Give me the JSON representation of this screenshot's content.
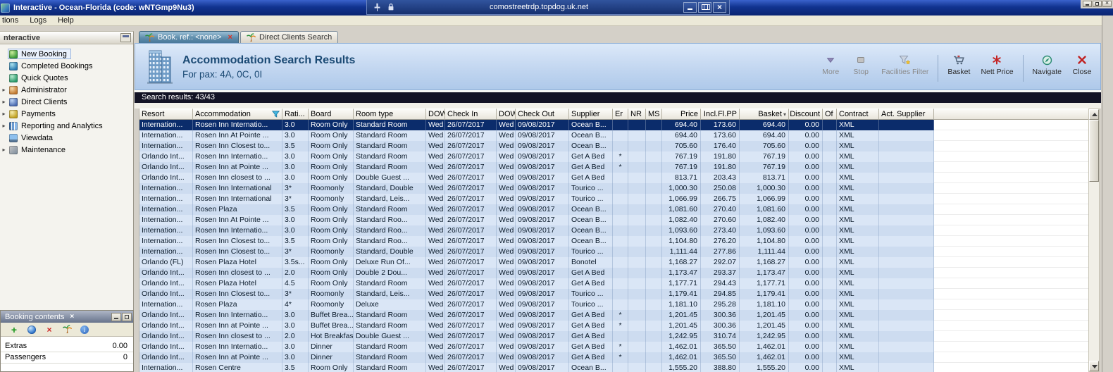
{
  "colors": {
    "selected_row": "#0b2c6b",
    "row_light": "#dae6f6",
    "row_dark": "#cddcf0",
    "titlebar": "#11338f",
    "results_bar": "#131325",
    "header_text": "#1b4a74"
  },
  "window": {
    "title": "Interactive - Ocean-Florida (code: wNTGmp9Nu3)",
    "rdp_host": "comostreetrdp.topdog.uk.net"
  },
  "menu": {
    "items": [
      "tions",
      "Logs",
      "Help"
    ]
  },
  "sidebar": {
    "title": "nteractive",
    "items": [
      {
        "label": "New Booking",
        "icon": "new-booking-icon",
        "selected": true,
        "expandable": false
      },
      {
        "label": "Completed Bookings",
        "icon": "completed-bookings-icon",
        "expandable": false
      },
      {
        "label": "Quick Quotes",
        "icon": "quick-quotes-icon",
        "expandable": false
      },
      {
        "label": "Administrator",
        "icon": "administrator-icon",
        "expandable": true
      },
      {
        "label": "Direct Clients",
        "icon": "direct-clients-icon",
        "expandable": true
      },
      {
        "label": "Payments",
        "icon": "payments-icon",
        "expandable": true
      },
      {
        "label": "Reporting and Analytics",
        "icon": "reporting-analytics-icon",
        "expandable": true
      },
      {
        "label": "Viewdata",
        "icon": "viewdata-icon",
        "expandable": false
      },
      {
        "label": "Maintenance",
        "icon": "maintenance-icon",
        "expandable": true
      }
    ]
  },
  "booking_contents": {
    "title": "Booking contents",
    "toolbar_icons": [
      "add-icon",
      "globe-icon",
      "delete-icon",
      "palm-icon",
      "info-icon"
    ],
    "rows": [
      {
        "label": "Extras",
        "value": "0.00"
      },
      {
        "label": "Passengers",
        "value": "0"
      }
    ]
  },
  "tabs": [
    {
      "label": "Book. ref.: <none>",
      "active": true,
      "closable": true
    },
    {
      "label": "Direct Clients Search",
      "active": false,
      "closable": false
    }
  ],
  "header": {
    "title": "Accommodation Search Results",
    "subtitle": "For pax: 4A, 0C, 0I",
    "toolbar": [
      {
        "label": "More",
        "icon": "more-icon",
        "disabled": true
      },
      {
        "label": "Stop",
        "icon": "stop-icon",
        "disabled": true
      },
      {
        "label": "Facilities Filter",
        "icon": "facilities-filter-icon",
        "disabled": true
      },
      {
        "separator": true
      },
      {
        "label": "Basket",
        "icon": "basket-icon",
        "disabled": false
      },
      {
        "label": "Nett Price",
        "icon": "nett-price-icon",
        "disabled": false
      },
      {
        "separator": true
      },
      {
        "label": "Navigate",
        "icon": "navigate-icon",
        "disabled": false
      },
      {
        "label": "Close",
        "icon": "close-red-icon",
        "disabled": false
      }
    ]
  },
  "results": {
    "status": "Search results: 43/43",
    "selected_row": 0,
    "columns": [
      "Resort",
      "Accommodation",
      "Rati...",
      "Board",
      "Room type",
      "DOW",
      "Check In",
      "DOW",
      "Check Out",
      "Supplier",
      "Er",
      "NR",
      "MS",
      "Price",
      "Incl.Fl.PP",
      "Basket",
      "Discount",
      "Of",
      "Contract",
      "Act. Supplier"
    ],
    "rows": [
      [
        "Internation...",
        "Rosen Inn Internatio...",
        "3.0",
        "Room Only",
        "Standard Room",
        "Wed",
        "26/07/2017",
        "Wed",
        "09/08/2017",
        "Ocean B...",
        "",
        "",
        "",
        "694.40",
        "173.60",
        "694.40",
        "0.00",
        "",
        "XML",
        ""
      ],
      [
        "Internation...",
        "Rosen Inn At Pointe ...",
        "3.0",
        "Room Only",
        "Standard Room",
        "Wed",
        "26/07/2017",
        "Wed",
        "09/08/2017",
        "Ocean B...",
        "",
        "",
        "",
        "694.40",
        "173.60",
        "694.40",
        "0.00",
        "",
        "XML",
        ""
      ],
      [
        "Internation...",
        "Rosen Inn Closest to...",
        "3.5",
        "Room Only",
        "Standard Room",
        "Wed",
        "26/07/2017",
        "Wed",
        "09/08/2017",
        "Ocean B...",
        "",
        "",
        "",
        "705.60",
        "176.40",
        "705.60",
        "0.00",
        "",
        "XML",
        ""
      ],
      [
        "Orlando Int...",
        "Rosen Inn Internatio...",
        "3.0",
        "Room Only",
        "Standard Room",
        "Wed",
        "26/07/2017",
        "Wed",
        "09/08/2017",
        "Get A Bed",
        "*",
        "",
        "",
        "767.19",
        "191.80",
        "767.19",
        "0.00",
        "",
        "XML",
        ""
      ],
      [
        "Orlando Int...",
        "Rosen Inn at Pointe ...",
        "3.0",
        "Room Only",
        "Standard Room",
        "Wed",
        "26/07/2017",
        "Wed",
        "09/08/2017",
        "Get A Bed",
        "*",
        "",
        "",
        "767.19",
        "191.80",
        "767.19",
        "0.00",
        "",
        "XML",
        ""
      ],
      [
        "Orlando Int...",
        "Rosen Inn closest to ...",
        "3.0",
        "Room Only",
        "Double Guest ...",
        "Wed",
        "26/07/2017",
        "Wed",
        "09/08/2017",
        "Get A Bed",
        "",
        "",
        "",
        "813.71",
        "203.43",
        "813.71",
        "0.00",
        "",
        "XML",
        ""
      ],
      [
        "Internation...",
        "Rosen Inn International",
        "3*",
        "Roomonly",
        "Standard, Double",
        "Wed",
        "26/07/2017",
        "Wed",
        "09/08/2017",
        "Tourico ...",
        "",
        "",
        "",
        "1,000.30",
        "250.08",
        "1,000.30",
        "0.00",
        "",
        "XML",
        ""
      ],
      [
        "Internation...",
        "Rosen Inn International",
        "3*",
        "Roomonly",
        "Standard, Leis...",
        "Wed",
        "26/07/2017",
        "Wed",
        "09/08/2017",
        "Tourico ...",
        "",
        "",
        "",
        "1,066.99",
        "266.75",
        "1,066.99",
        "0.00",
        "",
        "XML",
        ""
      ],
      [
        "Internation...",
        "Rosen Plaza",
        "3.5",
        "Room Only",
        "Standard Room",
        "Wed",
        "26/07/2017",
        "Wed",
        "09/08/2017",
        "Ocean B...",
        "",
        "",
        "",
        "1,081.60",
        "270.40",
        "1,081.60",
        "0.00",
        "",
        "XML",
        ""
      ],
      [
        "Internation...",
        "Rosen Inn At Pointe ...",
        "3.0",
        "Room Only",
        "Standard Roo...",
        "Wed",
        "26/07/2017",
        "Wed",
        "09/08/2017",
        "Ocean B...",
        "",
        "",
        "",
        "1,082.40",
        "270.60",
        "1,082.40",
        "0.00",
        "",
        "XML",
        ""
      ],
      [
        "Internation...",
        "Rosen Inn Internatio...",
        "3.0",
        "Room Only",
        "Standard Roo...",
        "Wed",
        "26/07/2017",
        "Wed",
        "09/08/2017",
        "Ocean B...",
        "",
        "",
        "",
        "1,093.60",
        "273.40",
        "1,093.60",
        "0.00",
        "",
        "XML",
        ""
      ],
      [
        "Internation...",
        "Rosen Inn Closest to...",
        "3.5",
        "Room Only",
        "Standard Roo...",
        "Wed",
        "26/07/2017",
        "Wed",
        "09/08/2017",
        "Ocean B...",
        "",
        "",
        "",
        "1,104.80",
        "276.20",
        "1,104.80",
        "0.00",
        "",
        "XML",
        ""
      ],
      [
        "Internation...",
        "Rosen Inn Closest to...",
        "3*",
        "Roomonly",
        "Standard, Double",
        "Wed",
        "26/07/2017",
        "Wed",
        "09/08/2017",
        "Tourico ...",
        "",
        "",
        "",
        "1,111.44",
        "277.86",
        "1,111.44",
        "0.00",
        "",
        "XML",
        ""
      ],
      [
        "Orlando (FL)",
        "Rosen Plaza Hotel",
        "3.5s...",
        "Room Only",
        "Deluxe Run Of...",
        "Wed",
        "26/07/2017",
        "Wed",
        "09/08/2017",
        "Bonotel",
        "",
        "",
        "",
        "1,168.27",
        "292.07",
        "1,168.27",
        "0.00",
        "",
        "XML",
        ""
      ],
      [
        "Orlando Int...",
        "Rosen Inn closest to ...",
        "2.0",
        "Room Only",
        "Double 2 Dou...",
        "Wed",
        "26/07/2017",
        "Wed",
        "09/08/2017",
        "Get A Bed",
        "",
        "",
        "",
        "1,173.47",
        "293.37",
        "1,173.47",
        "0.00",
        "",
        "XML",
        ""
      ],
      [
        "Orlando Int...",
        "Rosen Plaza Hotel",
        "4.5",
        "Room Only",
        "Standard Room",
        "Wed",
        "26/07/2017",
        "Wed",
        "09/08/2017",
        "Get A Bed",
        "",
        "",
        "",
        "1,177.71",
        "294.43",
        "1,177.71",
        "0.00",
        "",
        "XML",
        ""
      ],
      [
        "Orlando Int...",
        "Rosen Inn Closest to...",
        "3*",
        "Roomonly",
        "Standard, Leis...",
        "Wed",
        "26/07/2017",
        "Wed",
        "09/08/2017",
        "Tourico ...",
        "",
        "",
        "",
        "1,179.41",
        "294.85",
        "1,179.41",
        "0.00",
        "",
        "XML",
        ""
      ],
      [
        "Internation...",
        "Rosen Plaza",
        "4*",
        "Roomonly",
        "Deluxe",
        "Wed",
        "26/07/2017",
        "Wed",
        "09/08/2017",
        "Tourico ...",
        "",
        "",
        "",
        "1,181.10",
        "295.28",
        "1,181.10",
        "0.00",
        "",
        "XML",
        ""
      ],
      [
        "Orlando Int...",
        "Rosen Inn Internatio...",
        "3.0",
        "Buffet Brea...",
        "Standard Room",
        "Wed",
        "26/07/2017",
        "Wed",
        "09/08/2017",
        "Get A Bed",
        "*",
        "",
        "",
        "1,201.45",
        "300.36",
        "1,201.45",
        "0.00",
        "",
        "XML",
        ""
      ],
      [
        "Orlando Int...",
        "Rosen Inn at Pointe ...",
        "3.0",
        "Buffet Brea...",
        "Standard Room",
        "Wed",
        "26/07/2017",
        "Wed",
        "09/08/2017",
        "Get A Bed",
        "*",
        "",
        "",
        "1,201.45",
        "300.36",
        "1,201.45",
        "0.00",
        "",
        "XML",
        ""
      ],
      [
        "Orlando Int...",
        "Rosen Inn closest to ...",
        "2.0",
        "Hot Breakfast",
        "Double Guest ...",
        "Wed",
        "26/07/2017",
        "Wed",
        "09/08/2017",
        "Get A Bed",
        "",
        "",
        "",
        "1,242.95",
        "310.74",
        "1,242.95",
        "0.00",
        "",
        "XML",
        ""
      ],
      [
        "Orlando Int...",
        "Rosen Inn Internatio...",
        "3.0",
        "Dinner",
        "Standard Room",
        "Wed",
        "26/07/2017",
        "Wed",
        "09/08/2017",
        "Get A Bed",
        "*",
        "",
        "",
        "1,462.01",
        "365.50",
        "1,462.01",
        "0.00",
        "",
        "XML",
        ""
      ],
      [
        "Orlando Int...",
        "Rosen Inn at Pointe ...",
        "3.0",
        "Dinner",
        "Standard Room",
        "Wed",
        "26/07/2017",
        "Wed",
        "09/08/2017",
        "Get A Bed",
        "*",
        "",
        "",
        "1,462.01",
        "365.50",
        "1,462.01",
        "0.00",
        "",
        "XML",
        ""
      ],
      [
        "Internation...",
        "Rosen Centre",
        "3.5",
        "Room Only",
        "Standard Room",
        "Wed",
        "26/07/2017",
        "Wed",
        "09/08/2017",
        "Ocean B...",
        "",
        "",
        "",
        "1,555.20",
        "388.80",
        "1,555.20",
        "0.00",
        "",
        "XML",
        ""
      ]
    ]
  }
}
